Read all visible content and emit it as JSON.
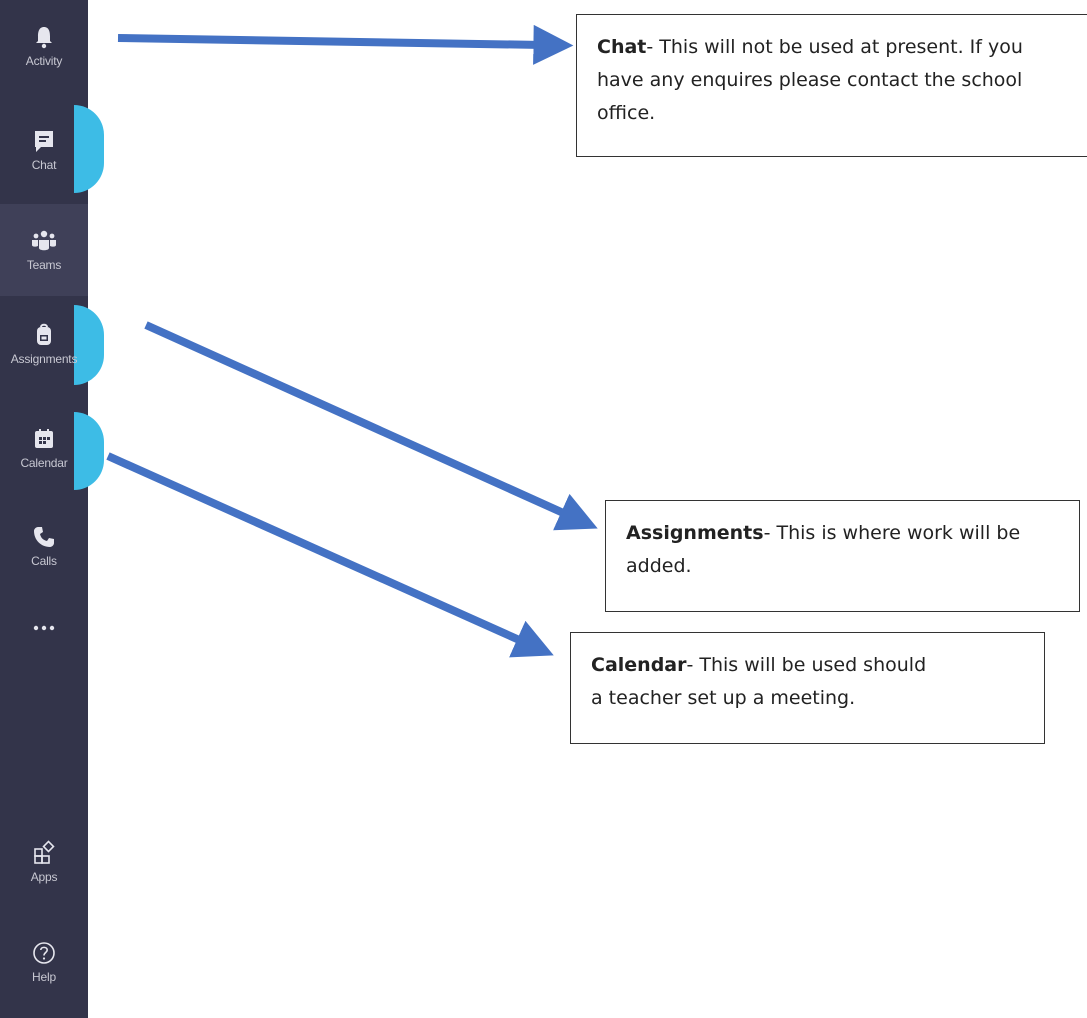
{
  "sidebar": {
    "items": [
      {
        "label": "Activity",
        "icon": "bell-icon"
      },
      {
        "label": "Chat",
        "icon": "chat-icon"
      },
      {
        "label": "Teams",
        "icon": "teams-icon",
        "active": true
      },
      {
        "label": "Assignments",
        "icon": "backpack-icon"
      },
      {
        "label": "Calendar",
        "icon": "calendar-icon"
      },
      {
        "label": "Calls",
        "icon": "phone-icon"
      },
      {
        "label": "",
        "icon": "more-icon"
      },
      {
        "label": "Apps",
        "icon": "apps-icon"
      },
      {
        "label": "Help",
        "icon": "help-icon"
      }
    ]
  },
  "notes": {
    "chat": {
      "title": "Chat",
      "text": "- This will not be used at present. If you have any enquires please contact the school office."
    },
    "assignments": {
      "title": "Assignments",
      "text": "- This is where work will be added."
    },
    "calendar": {
      "title": "Calendar",
      "text": "- This will be used should a teacher set up a meeting."
    }
  },
  "colors": {
    "sidebar": "#33344a",
    "highlight": "#3dbce6",
    "arrow": "#4472c4"
  }
}
